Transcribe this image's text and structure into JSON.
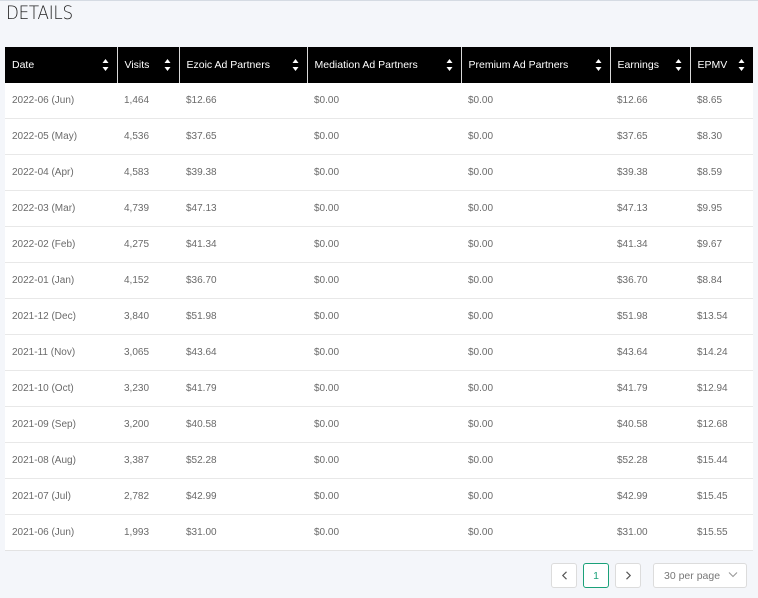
{
  "section": {
    "title": "DETAILS"
  },
  "table": {
    "columns": [
      "Date",
      "Visits",
      "Ezoic Ad Partners",
      "Mediation Ad Partners",
      "Premium Ad Partners",
      "Earnings",
      "EPMV"
    ],
    "rows": [
      [
        "2022-06 (Jun)",
        "1,464",
        "$12.66",
        "$0.00",
        "$0.00",
        "$12.66",
        "$8.65"
      ],
      [
        "2022-05 (May)",
        "4,536",
        "$37.65",
        "$0.00",
        "$0.00",
        "$37.65",
        "$8.30"
      ],
      [
        "2022-04 (Apr)",
        "4,583",
        "$39.38",
        "$0.00",
        "$0.00",
        "$39.38",
        "$8.59"
      ],
      [
        "2022-03 (Mar)",
        "4,739",
        "$47.13",
        "$0.00",
        "$0.00",
        "$47.13",
        "$9.95"
      ],
      [
        "2022-02 (Feb)",
        "4,275",
        "$41.34",
        "$0.00",
        "$0.00",
        "$41.34",
        "$9.67"
      ],
      [
        "2022-01 (Jan)",
        "4,152",
        "$36.70",
        "$0.00",
        "$0.00",
        "$36.70",
        "$8.84"
      ],
      [
        "2021-12 (Dec)",
        "3,840",
        "$51.98",
        "$0.00",
        "$0.00",
        "$51.98",
        "$13.54"
      ],
      [
        "2021-11 (Nov)",
        "3,065",
        "$43.64",
        "$0.00",
        "$0.00",
        "$43.64",
        "$14.24"
      ],
      [
        "2021-10 (Oct)",
        "3,230",
        "$41.79",
        "$0.00",
        "$0.00",
        "$41.79",
        "$12.94"
      ],
      [
        "2021-09 (Sep)",
        "3,200",
        "$40.58",
        "$0.00",
        "$0.00",
        "$40.58",
        "$12.68"
      ],
      [
        "2021-08 (Aug)",
        "3,387",
        "$52.28",
        "$0.00",
        "$0.00",
        "$52.28",
        "$15.44"
      ],
      [
        "2021-07 (Jul)",
        "2,782",
        "$42.99",
        "$0.00",
        "$0.00",
        "$42.99",
        "$15.45"
      ],
      [
        "2021-06 (Jun)",
        "1,993",
        "$31.00",
        "$0.00",
        "$0.00",
        "$31.00",
        "$15.55"
      ]
    ]
  },
  "pagination": {
    "current_page": "1",
    "page_size_label": "30 per page",
    "prev_icon": "chevron-left-icon",
    "next_icon": "chevron-right-icon",
    "accent_color": "#1aa179"
  },
  "icons": {
    "sort": "sort-toggle-icon"
  }
}
